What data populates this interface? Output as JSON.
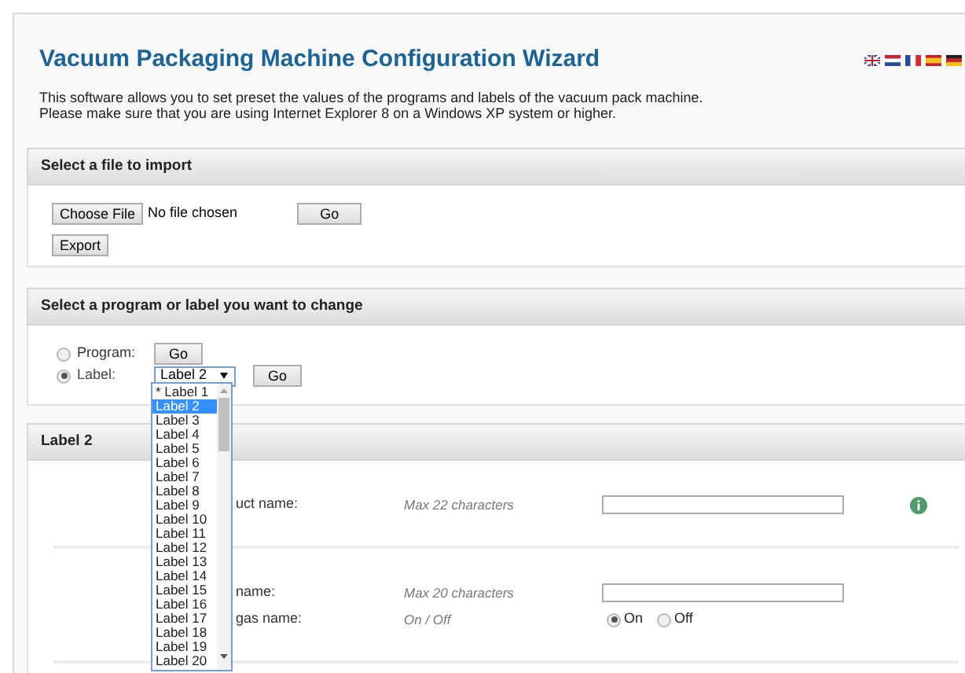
{
  "title": "Vacuum Packaging Machine Configuration Wizard",
  "description": [
    "This software allows you to set preset the values of the programs and labels of the vacuum pack machine.",
    "Please make sure that you are using Internet Explorer 8 on a Windows XP system or higher."
  ],
  "import_section": {
    "heading": "Select a file to import",
    "file_button": "Choose File",
    "file_status": "No file chosen",
    "go_button": "Go",
    "export_button": "Export"
  },
  "select_section": {
    "heading": "Select a program or label you want to change",
    "options": [
      {
        "label": "Program:",
        "selected": false,
        "kind": "button",
        "button": "Go"
      },
      {
        "label": "Label:",
        "selected": true,
        "kind": "select",
        "value": "Label 2",
        "button": "Go"
      }
    ],
    "label_list": [
      {
        "text": "* Label 1",
        "selected": false
      },
      {
        "text": "Label 2",
        "selected": true
      },
      {
        "text": "Label 3",
        "selected": false
      },
      {
        "text": "Label 4",
        "selected": false
      },
      {
        "text": "Label 5",
        "selected": false
      },
      {
        "text": "Label 6",
        "selected": false
      },
      {
        "text": "Label 7",
        "selected": false
      },
      {
        "text": "Label 8",
        "selected": false
      },
      {
        "text": "Label 9",
        "selected": false
      },
      {
        "text": "Label 10",
        "selected": false
      },
      {
        "text": "Label 11",
        "selected": false
      },
      {
        "text": "Label 12",
        "selected": false
      },
      {
        "text": "Label 13",
        "selected": false
      },
      {
        "text": "Label 14",
        "selected": false
      },
      {
        "text": "Label 15",
        "selected": false
      },
      {
        "text": "Label 16",
        "selected": false
      },
      {
        "text": "Label 17",
        "selected": false
      },
      {
        "text": "Label 18",
        "selected": false
      },
      {
        "text": "Label 19",
        "selected": false
      },
      {
        "text": "Label 20",
        "selected": false
      }
    ]
  },
  "label_section": {
    "heading": "Label 2",
    "groups": [
      [
        {
          "label": "uct name:",
          "hint": "Max 22 characters",
          "kind": "text",
          "info": true
        }
      ],
      [
        {
          "label": "name:",
          "hint": "Max 20 characters",
          "kind": "text",
          "info": false
        },
        {
          "label": "gas name:",
          "hint": "On / Off",
          "kind": "toggle",
          "options": [
            {
              "text": "On",
              "selected": true
            },
            {
              "text": "Off",
              "selected": false
            }
          ]
        }
      ]
    ]
  }
}
